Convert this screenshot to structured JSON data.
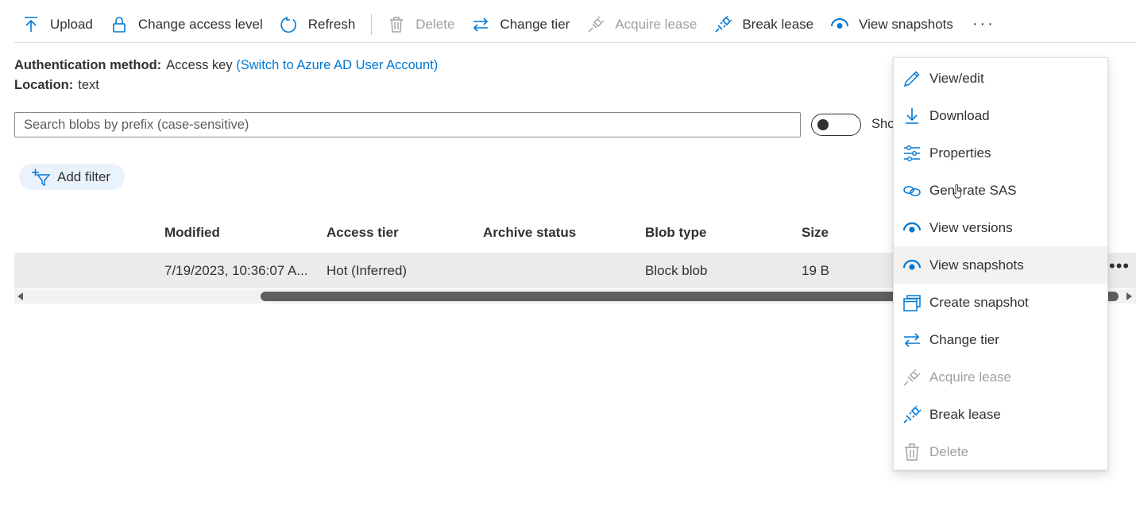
{
  "toolbar": {
    "items": [
      {
        "label": "Upload",
        "icon": "upload-icon",
        "enabled": true
      },
      {
        "label": "Change access level",
        "icon": "lock-icon",
        "enabled": true
      },
      {
        "label": "Refresh",
        "icon": "refresh-icon",
        "enabled": true
      },
      {
        "label": "Delete",
        "icon": "trash-icon",
        "enabled": false
      },
      {
        "label": "Change tier",
        "icon": "swap-arrows-icon",
        "enabled": true
      },
      {
        "label": "Acquire lease",
        "icon": "plug-icon",
        "enabled": false
      },
      {
        "label": "Break lease",
        "icon": "unplug-icon",
        "enabled": true
      },
      {
        "label": "View snapshots",
        "icon": "eye-icon",
        "enabled": true
      }
    ],
    "more_label": "···"
  },
  "info": {
    "auth_label": "Authentication method:",
    "auth_value": "Access key",
    "auth_link": "(Switch to Azure AD User Account)",
    "location_label": "Location:",
    "location_value": "text"
  },
  "search": {
    "placeholder": "Search blobs by prefix (case-sensitive)",
    "value": ""
  },
  "toggle": {
    "label": "Sho",
    "on": false
  },
  "filter": {
    "label": "Add filter",
    "icon": "add-filter-icon"
  },
  "table": {
    "columns": [
      "Modified",
      "Access tier",
      "Archive status",
      "Blob type",
      "Size"
    ],
    "rows": [
      {
        "modified": "7/19/2023, 10:36:07 A...",
        "access_tier": "Hot (Inferred)",
        "archive_status": "",
        "blob_type": "Block blob",
        "size": "19 B"
      }
    ],
    "row_more_label": "•••"
  },
  "context_menu": {
    "items": [
      {
        "label": "View/edit",
        "icon": "pencil-icon",
        "enabled": true
      },
      {
        "label": "Download",
        "icon": "download-icon",
        "enabled": true
      },
      {
        "label": "Properties",
        "icon": "sliders-icon",
        "enabled": true
      },
      {
        "label": "Generate SAS",
        "icon": "link-icon",
        "enabled": true
      },
      {
        "label": "View versions",
        "icon": "eye-icon",
        "enabled": true
      },
      {
        "label": "View snapshots",
        "icon": "eye-icon",
        "enabled": true,
        "highlighted": true
      },
      {
        "label": "Create snapshot",
        "icon": "snapshot-icon",
        "enabled": true
      },
      {
        "label": "Change tier",
        "icon": "swap-arrows-icon",
        "enabled": true
      },
      {
        "label": "Acquire lease",
        "icon": "plug-icon",
        "enabled": false
      },
      {
        "label": "Break lease",
        "icon": "unplug-icon",
        "enabled": true
      },
      {
        "label": "Delete",
        "icon": "trash-icon",
        "enabled": false
      }
    ]
  },
  "colors": {
    "accent": "#0078d4",
    "text": "#323130",
    "disabled": "#a19f9d",
    "row_selected": "#edebe9",
    "filter_pill": "#eaf2fb"
  }
}
